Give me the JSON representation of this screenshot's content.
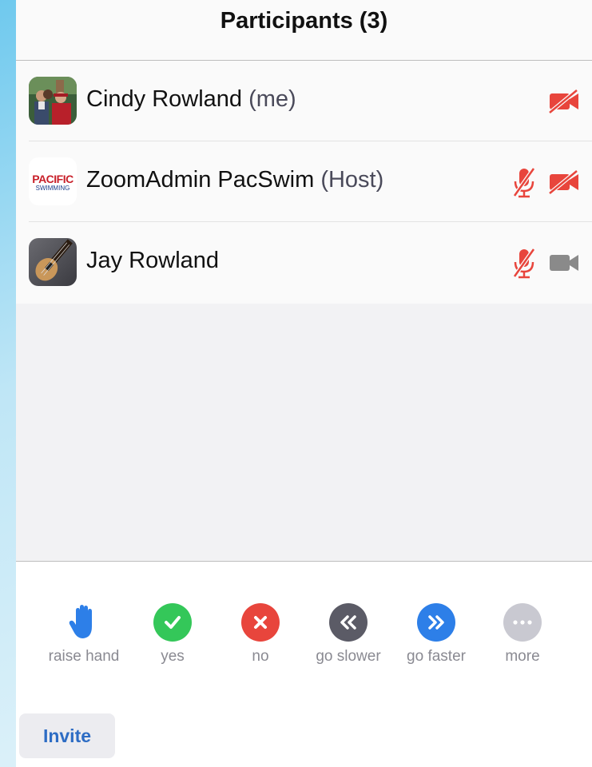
{
  "header": {
    "title": "Participants (3)"
  },
  "participants": [
    {
      "name": "Cindy Rowland",
      "role": "(me)",
      "mic": "none",
      "video": "off"
    },
    {
      "name": "ZoomAdmin PacSwim",
      "role": "(Host)",
      "mic": "muted",
      "video": "off",
      "avatar_text_top": "PACIFIC",
      "avatar_text_bottom": "SWIMMING"
    },
    {
      "name": "Jay Rowland",
      "role": "",
      "mic": "muted",
      "video": "on"
    }
  ],
  "reactions": [
    {
      "label": "raise hand",
      "icon": "raise-hand-icon",
      "color": "#2d7fe8"
    },
    {
      "label": "yes",
      "icon": "check-icon",
      "color": "#34c759"
    },
    {
      "label": "no",
      "icon": "x-icon",
      "color": "#e8453c"
    },
    {
      "label": "go slower",
      "icon": "go-slower-icon",
      "color": "#5b5b66"
    },
    {
      "label": "go faster",
      "icon": "go-faster-icon",
      "color": "#2d7fe8"
    },
    {
      "label": "more",
      "icon": "more-icon",
      "color": "#c9c9d1"
    }
  ],
  "footer": {
    "invite_label": "Invite"
  },
  "colors": {
    "muted_red": "#e8453c",
    "video_gray": "#8a8a8a",
    "accent_blue": "#2d6cc4"
  }
}
